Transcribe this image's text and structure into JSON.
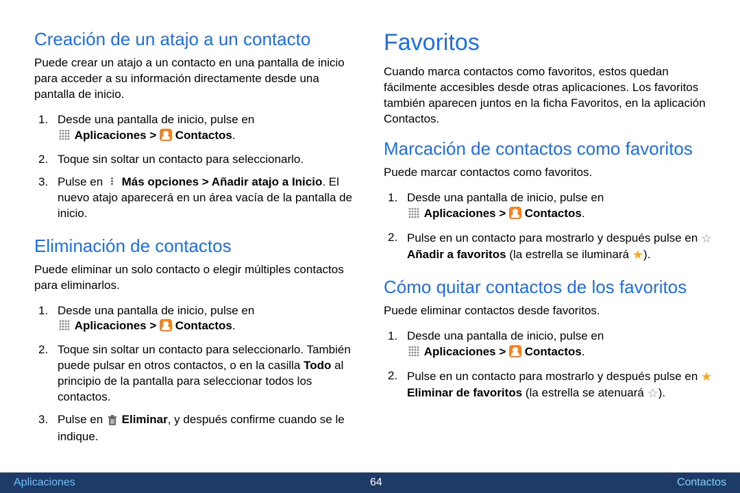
{
  "left": {
    "section1": {
      "heading": "Creación de un atajo a un contacto",
      "intro": "Puede crear un atajo a un contacto en una pantalla de inicio para acceder a su información directamente desde una pantalla de inicio.",
      "step1_a": "Desde una pantalla de inicio, pulse en",
      "step1_b_apps": "Aplicaciones >",
      "step1_b_contacts": "Contactos",
      "step1_period": ".",
      "step2": "Toque sin soltar un contacto para seleccionarlo.",
      "step3_a": "Pulse en",
      "step3_b": "Más opciones > Añadir atajo a Inicio",
      "step3_c": ". El nuevo atajo aparecerá en un área vacía de la pantalla de inicio."
    },
    "section2": {
      "heading": "Eliminación de contactos",
      "intro": "Puede eliminar un solo contacto o elegir múltiples contactos para eliminarlos.",
      "step1_a": "Desde una pantalla de inicio, pulse en",
      "step1_b_apps": "Aplicaciones >",
      "step1_b_contacts": "Contactos",
      "step1_period": ".",
      "step2_a": "Toque sin soltar un contacto para seleccionarlo. También puede pulsar en otros contactos, o en la casilla ",
      "step2_todo": "Todo",
      "step2_b": " al principio de la pantalla para seleccionar todos los contactos.",
      "step3_a": "Pulse en",
      "step3_b": "Eliminar",
      "step3_c": ", y después confirme cuando se le indique."
    }
  },
  "right": {
    "title": "Favoritos",
    "intro": "Cuando marca contactos como favoritos, estos quedan fácilmente accesibles desde otras aplicaciones. Los favoritos también aparecen juntos en la ficha Favoritos, en la aplicación Contactos.",
    "section1": {
      "heading": "Marcación de contactos como favoritos",
      "intro": "Puede marcar contactos como favoritos.",
      "step1_a": "Desde una pantalla de inicio, pulse en",
      "step1_b_apps": "Aplicaciones >",
      "step1_b_contacts": "Contactos",
      "step1_period": ".",
      "step2_a": "Pulse en un contacto para mostrarlo y después pulse en",
      "step2_b": "Añadir  a favoritos",
      "step2_c": "(la estrella se iluminará",
      "step2_d": ")."
    },
    "section2": {
      "heading": "Cómo quitar contactos de los favoritos",
      "intro": "Puede eliminar contactos desde favoritos.",
      "step1_a": "Desde una pantalla de inicio, pulse en",
      "step1_b_apps": "Aplicaciones >",
      "step1_b_contacts": "Contactos",
      "step1_period": ".",
      "step2_a": "Pulse en un contacto para mostrarlo y después pulse en",
      "step2_b": "Eliminar de favoritos",
      "step2_c": "(la estrella se atenuará",
      "step2_d": ")."
    }
  },
  "footer": {
    "left": "Aplicaciones",
    "center": "64",
    "right": "Contactos"
  }
}
